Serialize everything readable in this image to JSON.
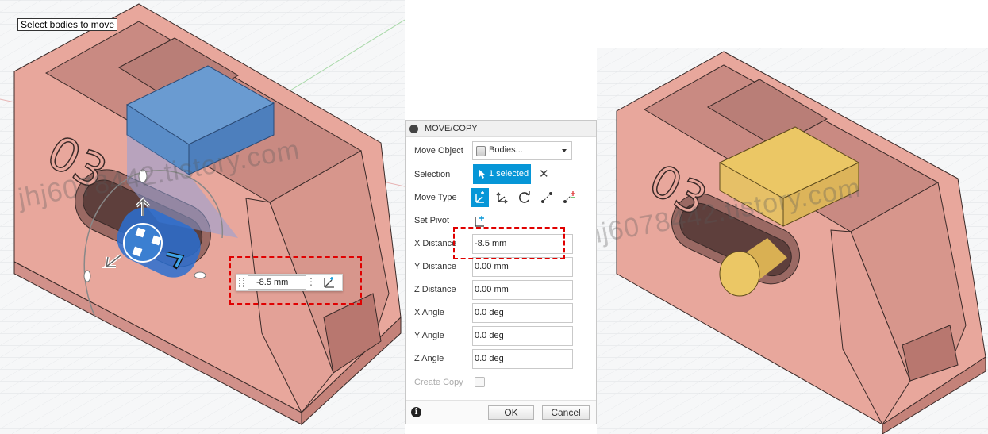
{
  "tooltip": "Select bodies to move",
  "watermark": "jhj6078442.tistory.com",
  "viewport_left": {
    "part_label": "03",
    "manipulator_value": "-8.5 mm"
  },
  "viewport_right": {
    "part_label": "03"
  },
  "dialog": {
    "title": "MOVE/COPY",
    "move_object": {
      "label": "Move Object",
      "value": "Bodies..."
    },
    "selection": {
      "label": "Selection",
      "value": "1 selected",
      "clear": "✕"
    },
    "move_type": {
      "label": "Move Type",
      "options": [
        "free-move-icon",
        "translate-icon",
        "rotate-icon",
        "point-to-point-icon",
        "point-to-position-icon"
      ],
      "active": 0
    },
    "set_pivot": {
      "label": "Set Pivot"
    },
    "x_distance": {
      "label": "X Distance",
      "value": "-8.5 mm"
    },
    "y_distance": {
      "label": "Y Distance",
      "value": "0.00 mm"
    },
    "z_distance": {
      "label": "Z Distance",
      "value": "0.00 mm"
    },
    "x_angle": {
      "label": "X Angle",
      "value": "0.0 deg"
    },
    "y_angle": {
      "label": "Y Angle",
      "value": "0.0 deg"
    },
    "z_angle": {
      "label": "Z Angle",
      "value": "0.0 deg"
    },
    "create_copy": {
      "label": "Create Copy",
      "checked": false
    },
    "ok": "OK",
    "cancel": "Cancel",
    "info": "i"
  },
  "colors": {
    "body_face": "#e8a79c",
    "body_edge": "#3a2a28",
    "selected_body": "#4f88c6",
    "moved_body": "#ebc765",
    "accent": "#0696d7",
    "highlight": "#e00000"
  }
}
